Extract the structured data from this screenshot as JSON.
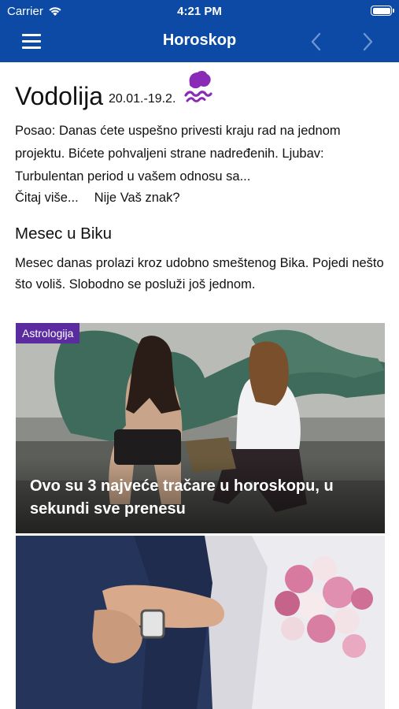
{
  "status_bar": {
    "carrier": "Carrier",
    "time": "4:21 PM"
  },
  "nav": {
    "title": "Horoskop",
    "icons": [
      "menu-icon",
      "chevron-left-icon",
      "chevron-right-icon"
    ]
  },
  "sign": {
    "name": "Vodolija",
    "dates": "20.01.-19.2.",
    "icon": "aquarius-symbol-icon",
    "icon_color": "#8a2bb8"
  },
  "daily": {
    "text": "Posao: Danas ćete uspešno privesti kraju rad na jednom projektu. Bićete pohvaljeni strane nadređenih. Ljubav: Turbulentan period u vašem odnosu sa...",
    "read_more": "Čitaj više...",
    "not_your_sign": "Nije Vaš znak?"
  },
  "moon": {
    "title": "Mesec u Biku",
    "text": "Mesec danas prolazi kroz udobno smeštenog Bika. Pojedi nešto što voliš. Slobodno se posluži još jednom."
  },
  "articles": [
    {
      "category": "Astrologija",
      "title": "Ovo su 3 najveće tračare u horoskopu, u sekundi sve prenesu"
    },
    {
      "category": "",
      "title": ""
    }
  ],
  "colors": {
    "header": "#0c4aa6",
    "badge": "#5b2ca0"
  }
}
